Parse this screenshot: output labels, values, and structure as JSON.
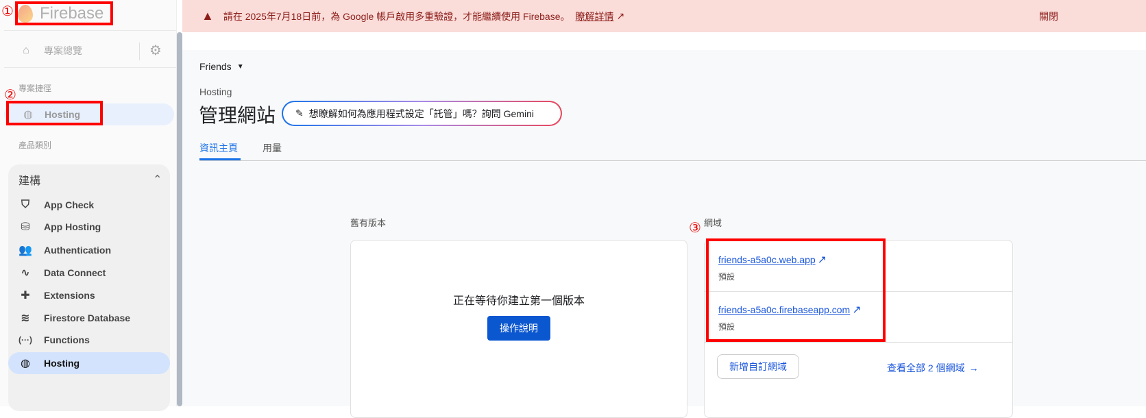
{
  "sidebar": {
    "brand": "Firebase",
    "overview": "專案總覽",
    "shortcuts_label": "專案捷徑",
    "shortcut_hosting": "Hosting",
    "categories_label": "產品類別",
    "group_title": "建構",
    "items": [
      {
        "label": "App Check",
        "icon": "shield-check-icon"
      },
      {
        "label": "App Hosting",
        "icon": "app-hosting-icon"
      },
      {
        "label": "Authentication",
        "icon": "people-icon"
      },
      {
        "label": "Data Connect",
        "icon": "data-connect-icon"
      },
      {
        "label": "Extensions",
        "icon": "puzzle-icon"
      },
      {
        "label": "Firestore Database",
        "icon": "firestore-icon"
      },
      {
        "label": "Functions",
        "icon": "functions-icon"
      },
      {
        "label": "Hosting",
        "icon": "globe-icon"
      }
    ]
  },
  "banner": {
    "message": "請在 2025年7月18日前，為 Google 帳戶啟用多重驗證，才能繼續使用 Firebase。",
    "link": "瞭解詳情",
    "close": "關閉"
  },
  "project": "Friends",
  "page": {
    "breadcrumb": "Hosting",
    "title": "管理網站",
    "gemini": "想瞭解如何為應用程式設定「託管」嗎？詢問 Gemini",
    "tabs": [
      "資訊主頁",
      "用量"
    ]
  },
  "releases": {
    "label": "舊有版本",
    "empty": "正在等待你建立第一個版本",
    "button": "操作說明"
  },
  "domains": {
    "label": "網域",
    "list": [
      {
        "url": "friends-a5a0c.web.app",
        "tag": "預設"
      },
      {
        "url": "friends-a5a0c.firebaseapp.com",
        "tag": "預設"
      }
    ],
    "add": "新增自訂網域",
    "view_all": "查看全部 2 個網域"
  },
  "annotations": [
    "①",
    "②",
    "③"
  ],
  "colors": {
    "accent": "#1a73e8",
    "banner_bg": "#fadcd9",
    "annot": "#ff0000"
  }
}
